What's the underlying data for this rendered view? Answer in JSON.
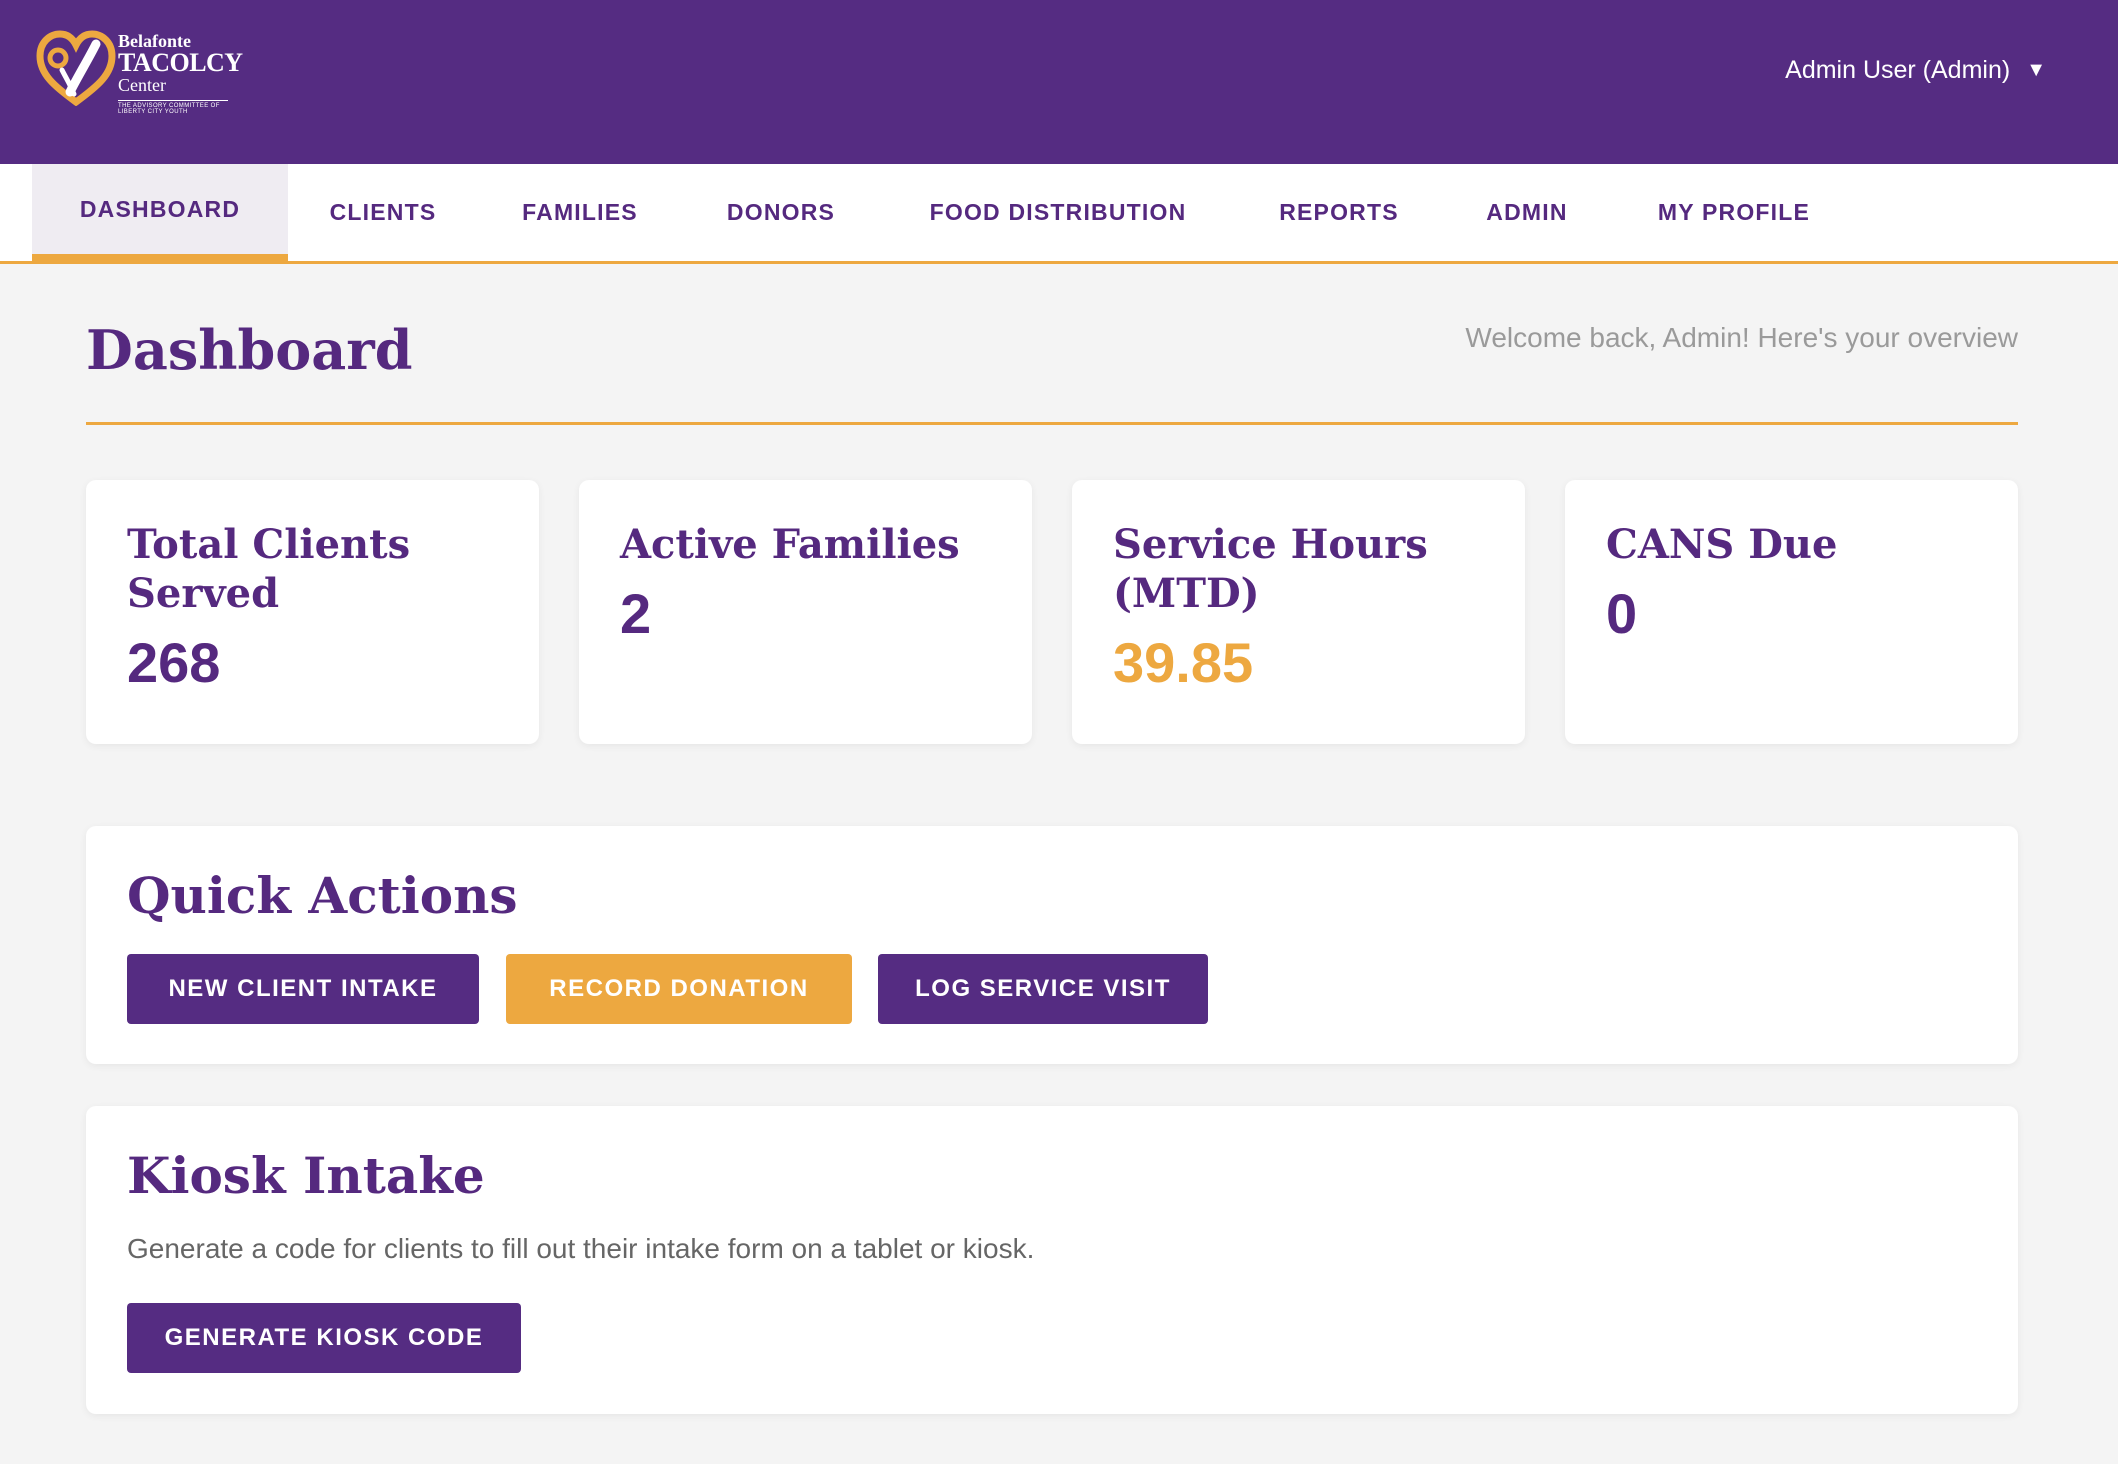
{
  "header": {
    "logo": {
      "line1": "Belafonte",
      "line2": "TACOLCY",
      "line3": "Center",
      "tagline": "THE ADVISORY COMMITTEE OF LIBERTY CITY YOUTH"
    },
    "user_menu_label": "Admin User (Admin)",
    "user_menu_caret": "▼"
  },
  "nav": {
    "items": [
      {
        "label": "DASHBOARD",
        "active": true
      },
      {
        "label": "CLIENTS"
      },
      {
        "label": "FAMILIES"
      },
      {
        "label": "DONORS"
      },
      {
        "label": "FOOD DISTRIBUTION"
      },
      {
        "label": "REPORTS"
      },
      {
        "label": "ADMIN"
      },
      {
        "label": "MY PROFILE"
      }
    ]
  },
  "page": {
    "title": "Dashboard",
    "welcome": "Welcome back, Admin! Here's your overview"
  },
  "stats": [
    {
      "label": "Total Clients Served",
      "value": "268"
    },
    {
      "label": "Active Families",
      "value": "2"
    },
    {
      "label": "Service Hours (MTD)",
      "value": "39.85"
    },
    {
      "label": "CANS Due",
      "value": "0"
    }
  ],
  "quick_actions": {
    "title": "Quick Actions",
    "buttons": [
      {
        "label": "NEW CLIENT INTAKE"
      },
      {
        "label": "RECORD DONATION"
      },
      {
        "label": "LOG SERVICE VISIT"
      }
    ]
  },
  "kiosk": {
    "title": "Kiosk Intake",
    "description": "Generate a code for clients to fill out their intake form on a tablet or kiosk.",
    "button_label": "GENERATE KIOSK CODE"
  },
  "colors": {
    "brand_purple": "#552c82",
    "accent_orange": "#eda840",
    "background": "#f4f4f4"
  }
}
